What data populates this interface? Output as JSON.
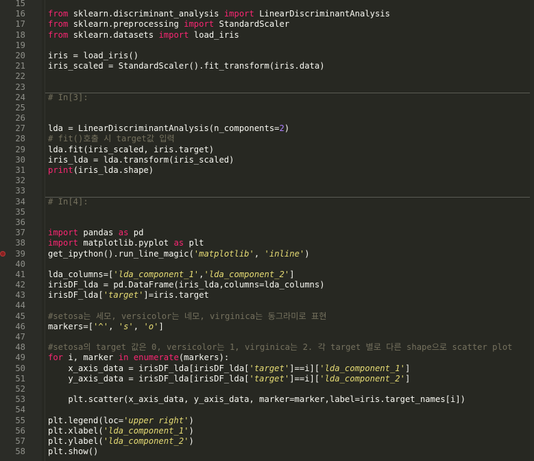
{
  "editor": {
    "lines": [
      {
        "num": "15",
        "tokens": []
      },
      {
        "num": "16",
        "tokens": [
          {
            "t": "from",
            "c": "kw"
          },
          {
            "t": " sklearn.discriminant_analysis ",
            "c": ""
          },
          {
            "t": "import",
            "c": "kw"
          },
          {
            "t": " LinearDiscriminantAnalysis",
            "c": ""
          }
        ]
      },
      {
        "num": "17",
        "tokens": [
          {
            "t": "from",
            "c": "kw"
          },
          {
            "t": " sklearn.preprocessing ",
            "c": ""
          },
          {
            "t": "import",
            "c": "kw"
          },
          {
            "t": " StandardScaler",
            "c": ""
          }
        ]
      },
      {
        "num": "18",
        "tokens": [
          {
            "t": "from",
            "c": "kw"
          },
          {
            "t": " sklearn.datasets ",
            "c": ""
          },
          {
            "t": "import",
            "c": "kw"
          },
          {
            "t": " load_iris",
            "c": ""
          }
        ]
      },
      {
        "num": "19",
        "tokens": []
      },
      {
        "num": "20",
        "tokens": [
          {
            "t": "iris = load_iris()",
            "c": ""
          }
        ]
      },
      {
        "num": "21",
        "tokens": [
          {
            "t": "iris_scaled = StandardScaler().fit_transform(iris.data)",
            "c": ""
          }
        ]
      },
      {
        "num": "22",
        "tokens": []
      },
      {
        "num": "23",
        "tokens": []
      },
      {
        "num": "24",
        "tokens": [
          {
            "t": "# In[3]:",
            "c": "cm"
          }
        ],
        "cell": true
      },
      {
        "num": "25",
        "tokens": []
      },
      {
        "num": "26",
        "tokens": []
      },
      {
        "num": "27",
        "tokens": [
          {
            "t": "lda = LinearDiscriminantAnalysis(n_components=",
            "c": ""
          },
          {
            "t": "2",
            "c": "num"
          },
          {
            "t": ")",
            "c": ""
          }
        ]
      },
      {
        "num": "28",
        "tokens": [
          {
            "t": "# fit()호출 시 target값 입력",
            "c": "cm"
          }
        ]
      },
      {
        "num": "29",
        "tokens": [
          {
            "t": "lda.fit(iris_scaled, iris.target)",
            "c": ""
          }
        ]
      },
      {
        "num": "30",
        "tokens": [
          {
            "t": "iris_lda = lda.transform(iris_scaled)",
            "c": ""
          }
        ]
      },
      {
        "num": "31",
        "tokens": [
          {
            "t": "print",
            "c": "kw"
          },
          {
            "t": "(iris_lda.shape)",
            "c": ""
          }
        ]
      },
      {
        "num": "32",
        "tokens": []
      },
      {
        "num": "33",
        "tokens": []
      },
      {
        "num": "34",
        "tokens": [
          {
            "t": "# In[4]:",
            "c": "cm"
          }
        ],
        "cell": true
      },
      {
        "num": "35",
        "tokens": []
      },
      {
        "num": "36",
        "tokens": []
      },
      {
        "num": "37",
        "tokens": [
          {
            "t": "import",
            "c": "kw"
          },
          {
            "t": " pandas ",
            "c": ""
          },
          {
            "t": "as",
            "c": "kw"
          },
          {
            "t": " pd",
            "c": ""
          }
        ]
      },
      {
        "num": "38",
        "tokens": [
          {
            "t": "import",
            "c": "kw"
          },
          {
            "t": " matplotlib.pyplot ",
            "c": ""
          },
          {
            "t": "as",
            "c": "kw"
          },
          {
            "t": " plt",
            "c": ""
          }
        ]
      },
      {
        "num": "39",
        "tokens": [
          {
            "t": "get_ipython().run_line_magic(",
            "c": ""
          },
          {
            "t": "'matplotlib'",
            "c": "str"
          },
          {
            "t": ", ",
            "c": ""
          },
          {
            "t": "'inline'",
            "c": "str"
          },
          {
            "t": ")",
            "c": ""
          }
        ],
        "breakpoint": true
      },
      {
        "num": "40",
        "tokens": []
      },
      {
        "num": "41",
        "tokens": [
          {
            "t": "lda_columns=[",
            "c": ""
          },
          {
            "t": "'lda_component_1'",
            "c": "str"
          },
          {
            "t": ",",
            "c": ""
          },
          {
            "t": "'lda_component_2'",
            "c": "str"
          },
          {
            "t": "]",
            "c": ""
          }
        ]
      },
      {
        "num": "42",
        "tokens": [
          {
            "t": "irisDF_lda = pd.DataFrame(iris_lda,columns=lda_columns)",
            "c": ""
          }
        ]
      },
      {
        "num": "43",
        "tokens": [
          {
            "t": "irisDF_lda[",
            "c": ""
          },
          {
            "t": "'target'",
            "c": "str"
          },
          {
            "t": "]=iris.target",
            "c": ""
          }
        ]
      },
      {
        "num": "44",
        "tokens": []
      },
      {
        "num": "45",
        "tokens": [
          {
            "t": "#setosa는 세모, versicolor는 네모, virginica는 동그라미로 표현",
            "c": "cm"
          }
        ]
      },
      {
        "num": "46",
        "tokens": [
          {
            "t": "markers=[",
            "c": ""
          },
          {
            "t": "'^'",
            "c": "str"
          },
          {
            "t": ", ",
            "c": ""
          },
          {
            "t": "'s'",
            "c": "str"
          },
          {
            "t": ", ",
            "c": ""
          },
          {
            "t": "'o'",
            "c": "str"
          },
          {
            "t": "]",
            "c": ""
          }
        ]
      },
      {
        "num": "47",
        "tokens": []
      },
      {
        "num": "48",
        "tokens": [
          {
            "t": "#setosa의 target 값은 0, versicolor는 1, virginica는 2. 각 target 별로 다른 shape으로 scatter plot",
            "c": "cm"
          }
        ]
      },
      {
        "num": "49",
        "tokens": [
          {
            "t": "for",
            "c": "kw"
          },
          {
            "t": " i, marker ",
            "c": ""
          },
          {
            "t": "in",
            "c": "kw"
          },
          {
            "t": " ",
            "c": ""
          },
          {
            "t": "enumerate",
            "c": "kw"
          },
          {
            "t": "(markers):",
            "c": ""
          }
        ]
      },
      {
        "num": "50",
        "tokens": [
          {
            "t": "    x_axis_data = irisDF_lda[irisDF_lda[",
            "c": ""
          },
          {
            "t": "'target'",
            "c": "str"
          },
          {
            "t": "]==i][",
            "c": ""
          },
          {
            "t": "'lda_component_1'",
            "c": "str"
          },
          {
            "t": "]",
            "c": ""
          }
        ]
      },
      {
        "num": "51",
        "tokens": [
          {
            "t": "    y_axis_data = irisDF_lda[irisDF_lda[",
            "c": ""
          },
          {
            "t": "'target'",
            "c": "str"
          },
          {
            "t": "]==i][",
            "c": ""
          },
          {
            "t": "'lda_component_2'",
            "c": "str"
          },
          {
            "t": "]",
            "c": ""
          }
        ]
      },
      {
        "num": "52",
        "tokens": []
      },
      {
        "num": "53",
        "tokens": [
          {
            "t": "    plt.scatter(x_axis_data, y_axis_data, marker=marker,label=iris.target_names[i])",
            "c": ""
          }
        ]
      },
      {
        "num": "54",
        "tokens": []
      },
      {
        "num": "55",
        "tokens": [
          {
            "t": "plt.legend(loc=",
            "c": ""
          },
          {
            "t": "'upper right'",
            "c": "str"
          },
          {
            "t": ")",
            "c": ""
          }
        ]
      },
      {
        "num": "56",
        "tokens": [
          {
            "t": "plt.xlabel(",
            "c": ""
          },
          {
            "t": "'lda_component_1'",
            "c": "str"
          },
          {
            "t": ")",
            "c": ""
          }
        ]
      },
      {
        "num": "57",
        "tokens": [
          {
            "t": "plt.ylabel(",
            "c": ""
          },
          {
            "t": "'lda_component_2'",
            "c": "str"
          },
          {
            "t": ")",
            "c": ""
          }
        ]
      },
      {
        "num": "58",
        "tokens": [
          {
            "t": "plt.show()",
            "c": ""
          }
        ]
      }
    ]
  }
}
